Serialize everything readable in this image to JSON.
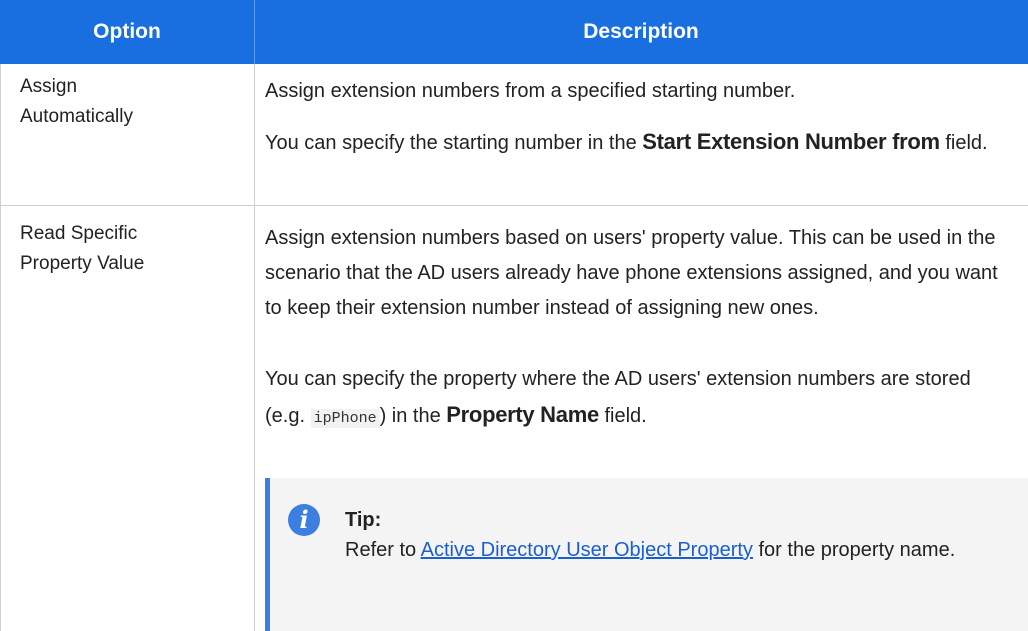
{
  "table": {
    "headers": {
      "option": "Option",
      "description": "Description"
    },
    "rows": [
      {
        "option": [
          "Assign",
          "Automatically"
        ],
        "paragraphs": [
          {
            "text": "Assign extension numbers from a specified starting number."
          },
          {
            "prefix": "You can specify the starting number in the ",
            "bold": "Start Extension Number from",
            "suffix": " field."
          }
        ]
      },
      {
        "option": [
          "Read Specific",
          "Property Value"
        ],
        "paragraphs": [
          {
            "text": "Assign extension numbers based on users' property value. This can be used in the scenario that the AD users already have phone extensions assigned, and you want to keep their extension number instead of assigning new ones."
          },
          {
            "prefix": "You can specify the property where the AD users' extension numbers are stored (e.g. ",
            "code": "ipPhone",
            "middle": ") in the ",
            "bold": "Property Name",
            "suffix": " field."
          }
        ],
        "tip": {
          "icon": "info-icon",
          "title": "Tip:",
          "prefix": "Refer to ",
          "link": "Active Directory User Object Property",
          "suffix": " for the property name."
        }
      }
    ]
  },
  "colors": {
    "header_bg": "#1a6fe0",
    "tip_accent": "#3d7fe0",
    "link": "#1a5fd0"
  }
}
